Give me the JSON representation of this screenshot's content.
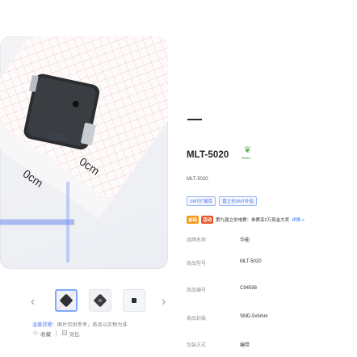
{
  "product": {
    "title": "MLT-5020",
    "rohs_label": "RoHS",
    "model_sub": "MLT-5020",
    "tags": [
      "SMT扩展库",
      "嘉立创SMT补贴"
    ],
    "promo": {
      "badge1": "金码",
      "badge2": "活动",
      "text": "第九届立创电赛：参赛享2万现金大奖",
      "more": "详情 >"
    },
    "specs": [
      {
        "label": "品牌名称",
        "value": "华能"
      },
      {
        "label": "商品型号",
        "value": "MLT-5020"
      },
      {
        "label": "商品编号",
        "value": "C94598"
      },
      {
        "label": "商品封装",
        "value": "SMD,5x5mm"
      },
      {
        "label": "包装方式",
        "value": "编带"
      }
    ]
  },
  "gallery": {
    "ruler_labels": [
      "0cm",
      "0cm"
    ],
    "prev": "‹",
    "next": "›",
    "tip_warn": "温馨提醒：",
    "tip": "图片仅供参考，商品以实物为准",
    "favorite": "收藏",
    "compare": "对比"
  },
  "colors": {
    "accent": "#4d7cf0",
    "promo_orange": "#f59a1b",
    "promo_red": "#e85a2b",
    "rohs_green": "#5cb85c"
  }
}
